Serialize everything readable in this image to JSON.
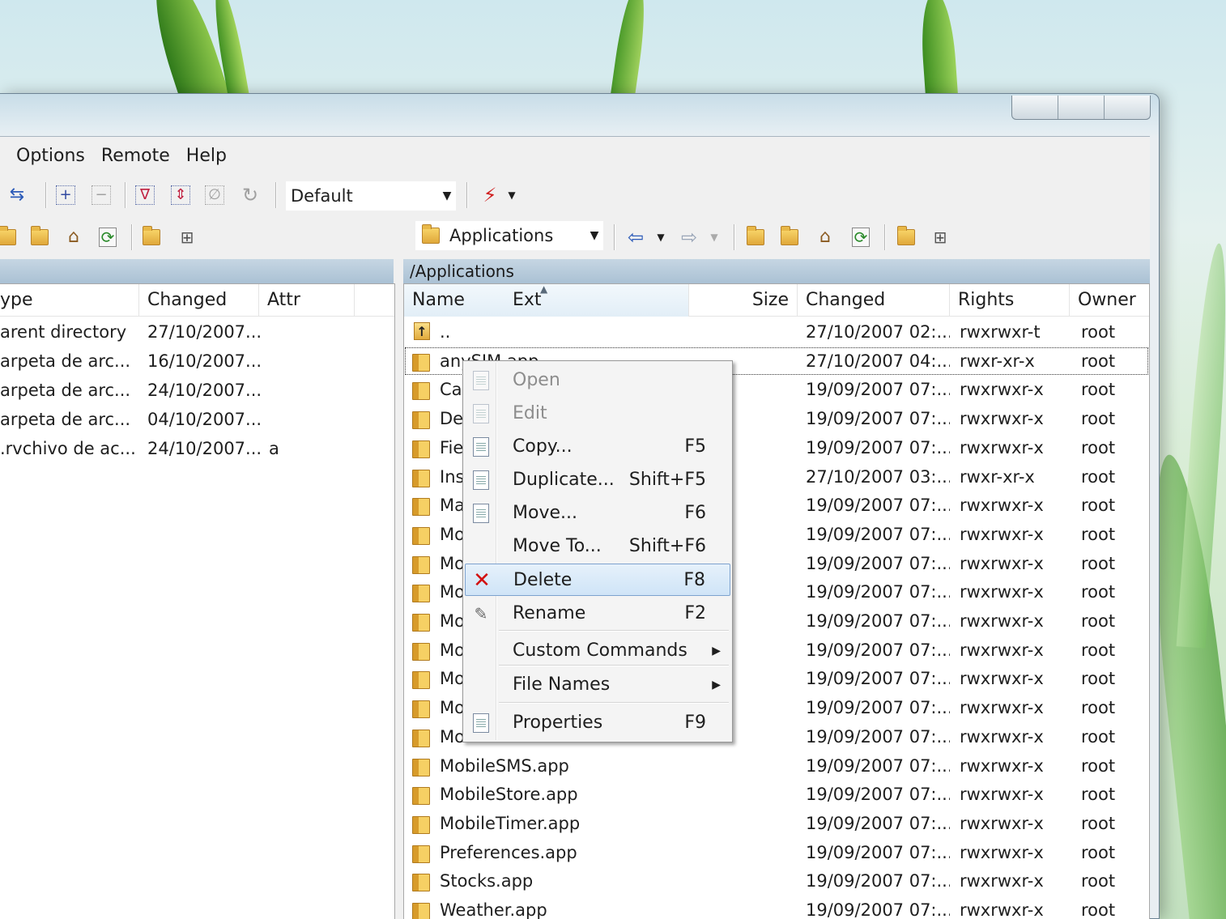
{
  "menubar": [
    "Options",
    "Remote",
    "Help"
  ],
  "toolbar": {
    "transfer_preset": "Default"
  },
  "left_panel": {
    "columns": [
      "ype",
      "Changed",
      "Attr"
    ],
    "rows": [
      {
        "type": "arent directory",
        "changed": "27/10/2007...",
        "attr": ""
      },
      {
        "type": "arpeta de arc...",
        "changed": "16/10/2007...",
        "attr": ""
      },
      {
        "type": "arpeta de arc...",
        "changed": "24/10/2007...",
        "attr": ""
      },
      {
        "type": "arpeta de arc...",
        "changed": "04/10/2007...",
        "attr": ""
      },
      {
        "type": ".rvchivo de ac...",
        "changed": "24/10/2007...",
        "attr": "a"
      }
    ]
  },
  "right_panel": {
    "directory": "Applications",
    "path": "/Applications",
    "columns": {
      "name": "Name",
      "ext": "Ext",
      "size": "Size",
      "changed": "Changed",
      "rights": "Rights",
      "owner": "Owner"
    },
    "rows": [
      {
        "name": "..",
        "changed": "27/10/2007 02:...",
        "rights": "rwxrwxr-t",
        "owner": "root"
      },
      {
        "name": "anySIM.app",
        "changed": "27/10/2007 04:...",
        "rights": "rwxr-xr-x",
        "owner": "root"
      },
      {
        "name": "Cal",
        "changed": "19/09/2007 07:...",
        "rights": "rwxrwxr-x",
        "owner": "root"
      },
      {
        "name": "De",
        "changed": "19/09/2007 07:...",
        "rights": "rwxrwxr-x",
        "owner": "root"
      },
      {
        "name": "Fie",
        "changed": "19/09/2007 07:...",
        "rights": "rwxrwxr-x",
        "owner": "root"
      },
      {
        "name": "Ins",
        "changed": "27/10/2007 03:...",
        "rights": "rwxr-xr-x",
        "owner": "root"
      },
      {
        "name": "Ma",
        "changed": "19/09/2007 07:...",
        "rights": "rwxrwxr-x",
        "owner": "root"
      },
      {
        "name": "Mo",
        "changed": "19/09/2007 07:...",
        "rights": "rwxrwxr-x",
        "owner": "root"
      },
      {
        "name": "Mo",
        "changed": "19/09/2007 07:...",
        "rights": "rwxrwxr-x",
        "owner": "root"
      },
      {
        "name": "Mo",
        "changed": "19/09/2007 07:...",
        "rights": "rwxrwxr-x",
        "owner": "root"
      },
      {
        "name": "Mo",
        "changed": "19/09/2007 07:...",
        "rights": "rwxrwxr-x",
        "owner": "root"
      },
      {
        "name": "Mo",
        "changed": "19/09/2007 07:...",
        "rights": "rwxrwxr-x",
        "owner": "root"
      },
      {
        "name": "Mo",
        "changed": "19/09/2007 07:...",
        "rights": "rwxrwxr-x",
        "owner": "root"
      },
      {
        "name": "Mo",
        "changed": "19/09/2007 07:...",
        "rights": "rwxrwxr-x",
        "owner": "root"
      },
      {
        "name": "Mo",
        "changed": "19/09/2007 07:...",
        "rights": "rwxrwxr-x",
        "owner": "root"
      },
      {
        "name": "MobileSMS.app",
        "changed": "19/09/2007 07:...",
        "rights": "rwxrwxr-x",
        "owner": "root"
      },
      {
        "name": "MobileStore.app",
        "changed": "19/09/2007 07:...",
        "rights": "rwxrwxr-x",
        "owner": "root"
      },
      {
        "name": "MobileTimer.app",
        "changed": "19/09/2007 07:...",
        "rights": "rwxrwxr-x",
        "owner": "root"
      },
      {
        "name": "Preferences.app",
        "changed": "19/09/2007 07:...",
        "rights": "rwxrwxr-x",
        "owner": "root"
      },
      {
        "name": "Stocks.app",
        "changed": "19/09/2007 07:...",
        "rights": "rwxrwxr-x",
        "owner": "root"
      },
      {
        "name": "Weather.app",
        "changed": "19/09/2007 07:...",
        "rights": "rwxrwxr-x",
        "owner": "root"
      }
    ]
  },
  "context_menu": {
    "items": [
      {
        "label": "Open",
        "shortcut": "",
        "icon": "open-icon",
        "disabled": true
      },
      {
        "label": "Edit",
        "shortcut": "",
        "icon": "edit-icon",
        "disabled": true
      },
      {
        "label": "Copy...",
        "shortcut": "F5",
        "icon": "copy-icon"
      },
      {
        "label": "Duplicate...",
        "shortcut": "Shift+F5",
        "icon": "duplicate-icon"
      },
      {
        "label": "Move...",
        "shortcut": "F6",
        "icon": "move-icon"
      },
      {
        "label": "Move To...",
        "shortcut": "Shift+F6",
        "icon": ""
      },
      {
        "label": "Delete",
        "shortcut": "F8",
        "icon": "delete-icon",
        "highlighted": true
      },
      {
        "label": "Rename",
        "shortcut": "F2",
        "icon": "rename-icon"
      },
      {
        "label": "Custom Commands",
        "shortcut": "",
        "submenu": true
      },
      {
        "label": "File Names",
        "shortcut": "",
        "submenu": true
      },
      {
        "label": "Properties",
        "shortcut": "F9",
        "icon": "properties-icon"
      }
    ]
  }
}
